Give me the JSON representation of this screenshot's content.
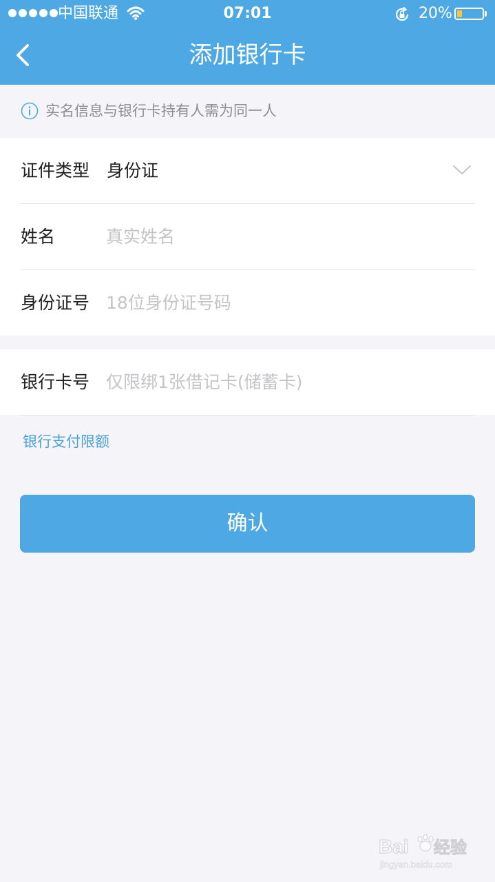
{
  "status_bar": {
    "carrier": "中国联通",
    "time": "07:01",
    "battery_percent_text": "20%",
    "battery_level": 0.2,
    "icons": [
      "signal-dots-icon",
      "wifi-icon",
      "rotation-lock-icon",
      "battery-icon"
    ]
  },
  "nav": {
    "title": "添加银行卡",
    "back_icon": "chevron-left-icon"
  },
  "notice": {
    "icon": "info-icon",
    "text": "实名信息与银行卡持有人需为同一人"
  },
  "form": {
    "id_type": {
      "label": "证件类型",
      "value": "身份证",
      "icon": "chevron-down-icon"
    },
    "name": {
      "label": "姓名",
      "placeholder": "真实姓名",
      "value": ""
    },
    "id_number": {
      "label": "身份证号",
      "placeholder": "18位身份证号码",
      "value": ""
    },
    "card_number": {
      "label": "银行卡号",
      "placeholder": "仅限绑1张借记卡(储蓄卡)",
      "value": ""
    }
  },
  "limits_link": "银行支付限额",
  "confirm_button": "确认",
  "watermark": {
    "brand": "Baidu经验",
    "url": "jingyan.baidu.com"
  },
  "colors": {
    "primary": "#4ea8e3",
    "background": "#f5f4f9",
    "link": "#4a9fd6",
    "placeholder": "#c4c4c8"
  }
}
